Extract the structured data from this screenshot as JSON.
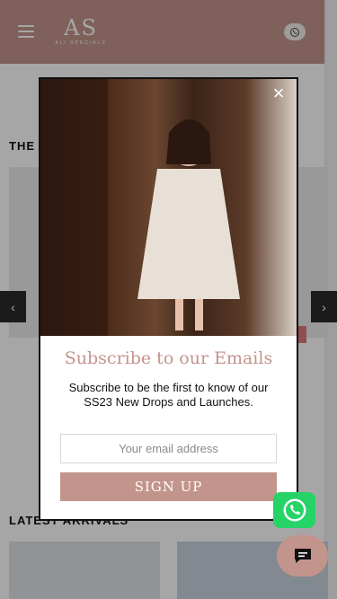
{
  "brand": {
    "logo_mark": "AS",
    "logo_sub": "ALI SPECIALS"
  },
  "header": {
    "menu_icon": "hamburger-menu-icon",
    "whatsapp_icon": "whatsapp-icon"
  },
  "sections": {
    "top_title": "THE A",
    "latest_title": "LATEST ARRIVALS"
  },
  "carousel": {
    "prev": "‹",
    "next": "›"
  },
  "modal": {
    "close_glyph": "×",
    "title": "Subscribe to our Emails",
    "description": "Subscribe to be the first to know of our SS23 New Drops and Launches.",
    "email_placeholder": "Your email address",
    "signup_label": "SIGN UP"
  },
  "colors": {
    "brand": "#c3948b",
    "whatsapp": "#25d366",
    "overlay": "rgba(0,0,0,0.35)"
  }
}
